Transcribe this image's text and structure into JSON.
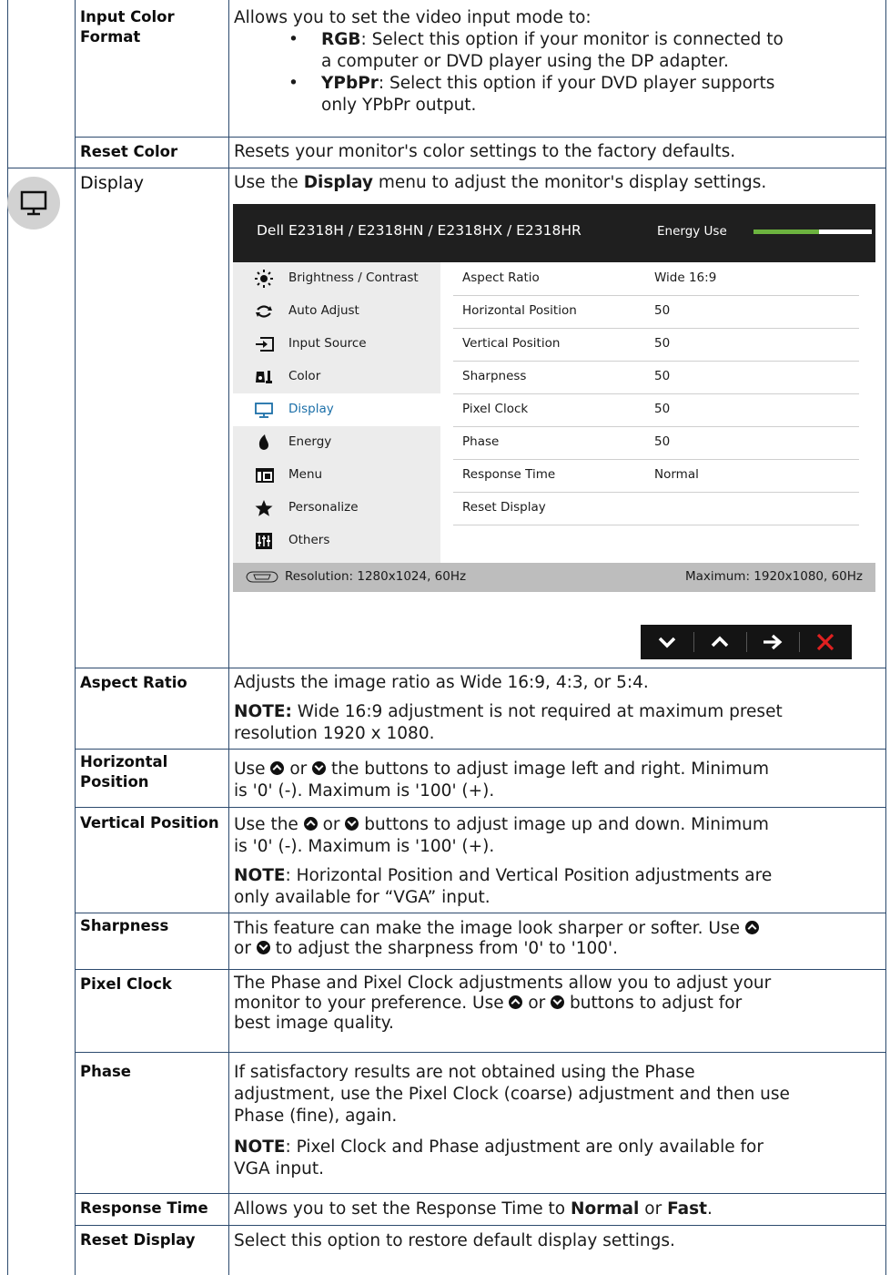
{
  "rows": {
    "input_color": {
      "name_lines": [
        "Input Color",
        "Format"
      ],
      "intro": "Allows you to set the video input mode to:",
      "bullets": [
        {
          "term": "RGB",
          "lines": [
            ": Select this option if your monitor is connected to",
            "a computer or DVD player using the DP adapter."
          ]
        },
        {
          "term": "YPbPr",
          "lines": [
            ": Select this option if your DVD player supports",
            "only YPbPr output."
          ]
        }
      ]
    },
    "reset_color": {
      "name": "Reset Color",
      "desc": "Resets your monitor's color settings to the factory defaults."
    },
    "display": {
      "name": "Display",
      "desc_pre": "Use the ",
      "desc_bold": "Display",
      "desc_post": " menu to adjust the monitor's display settings."
    },
    "aspect_ratio": {
      "name": "Aspect Ratio",
      "desc": "Adjusts the image ratio as Wide 16:9, 4:3, or 5:4.",
      "note_label": "NOTE:",
      "note_lines": [
        " Wide 16:9 adjustment is not required at maximum preset",
        "resolution 1920 x 1080."
      ]
    },
    "horizontal": {
      "name_lines": [
        "Horizontal",
        "Position"
      ],
      "lines": [
        "Use [up] or [dn] the buttons to adjust image left and right. Minimum",
        "is '0' (-). Maximum is '100' (+)."
      ],
      "pre": "Use ",
      "mid1": " or ",
      "post": " the buttons to adjust image left and right. Minimum",
      "line2": "is '0' (-). Maximum is '100' (+)."
    },
    "vertical": {
      "name": "Vertical Position",
      "pre": " Use the ",
      "mid1": " or ",
      "post": " buttons to adjust image up and down. Minimum",
      "line2": "is '0' (-). Maximum is '100' (+).",
      "note_label": "NOTE",
      "note_line1": ": Horizontal Position and Vertical Position adjustments are",
      "note_line2": "only available for “VGA” input."
    },
    "sharpness": {
      "name": "Sharpness",
      "line1": "This feature can make the image look sharper or softer. Use ",
      "line2_pre": "or ",
      "line2_post": " to adjust the sharpness from '0' to '100'."
    },
    "pixel_clock": {
      "name": "Pixel Clock",
      "line1": "The Phase and Pixel Clock adjustments allow you to adjust your",
      "line2_pre": "monitor to your preference. Use ",
      "line2_mid": " or ",
      "line2_post": " buttons to adjust for",
      "line3": "best image quality."
    },
    "phase": {
      "name": "Phase",
      "lines": [
        "If satisfactory results are not obtained using the Phase",
        "adjustment, use the Pixel Clock (coarse) adjustment and then use",
        "Phase (fine), again."
      ],
      "note_label": "NOTE",
      "note_line1": ": Pixel Clock and Phase adjustment are only available for",
      "note_line2": "VGA input."
    },
    "response_time": {
      "name": "Response Time",
      "pre": "Allows you to set the Response Time to ",
      "opt1": "Normal",
      "mid": " or ",
      "opt2": "Fast",
      "post": "."
    },
    "reset_display": {
      "name": "Reset Display",
      "desc": "Select this option to restore default display settings."
    }
  },
  "osd": {
    "model": "Dell E2318H / E2318HN / E2318HX / E2318HR",
    "energy_label": "Energy Use",
    "energy_level": 0.55,
    "menu": [
      {
        "label": "Brightness / Contrast",
        "icon": "brightness-icon",
        "active": false
      },
      {
        "label": "Auto Adjust",
        "icon": "auto-adjust-icon",
        "active": false
      },
      {
        "label": "Input Source",
        "icon": "input-source-icon",
        "active": false
      },
      {
        "label": "Color",
        "icon": "color-icon",
        "active": false
      },
      {
        "label": "Display",
        "icon": "display-icon",
        "active": true
      },
      {
        "label": "Energy",
        "icon": "energy-icon",
        "active": false
      },
      {
        "label": "Menu",
        "icon": "menu-icon",
        "active": false
      },
      {
        "label": "Personalize",
        "icon": "star-icon",
        "active": false
      },
      {
        "label": "Others",
        "icon": "others-icon",
        "active": false
      }
    ],
    "settings": [
      {
        "key": "Aspect Ratio",
        "value": "Wide 16:9"
      },
      {
        "key": "Horizontal Position",
        "value": "50"
      },
      {
        "key": "Vertical Position",
        "value": "50"
      },
      {
        "key": "Sharpness",
        "value": "50"
      },
      {
        "key": "Pixel Clock",
        "value": "50"
      },
      {
        "key": "Phase",
        "value": "50"
      },
      {
        "key": "Response Time",
        "value": "Normal"
      },
      {
        "key": "Reset Display",
        "value": ""
      }
    ],
    "resolution": "Resolution: 1280x1024, 60Hz",
    "maximum": "Maximum: 1920x1080, 60Hz",
    "nav_buttons": [
      "down-icon",
      "up-icon",
      "right-arrow-icon",
      "close-icon"
    ]
  },
  "colors": {
    "accent": "#1b6fa8",
    "energy": "#6cb33f",
    "close": "#e02020",
    "grid": "#2c4a6e"
  }
}
